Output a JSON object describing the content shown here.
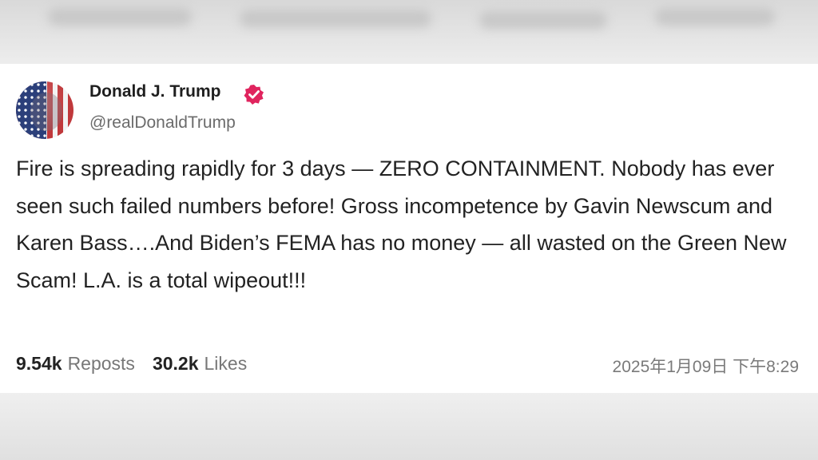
{
  "post": {
    "author_name": "Donald J. Trump",
    "author_handle": "@realDonaldTrump",
    "verified_color": "#e0245e",
    "text": "Fire is spreading rapidly for 3 days — ZERO CONTAINMENT. Nobody has ever seen such failed numbers before! Gross incompetence by Gavin Newscum and Karen Bass….And Biden’s FEMA has no money — all wasted on the Green New Scam! L.A. is a total wipeout!!!",
    "reposts_count": "9.54k",
    "reposts_label": "Reposts",
    "likes_count": "30.2k",
    "likes_label": "Likes",
    "timestamp": "2025年1月09日 下午8:29"
  },
  "icons": {
    "verified": "verified-badge-icon",
    "avatar": "flag-portrait-avatar"
  }
}
